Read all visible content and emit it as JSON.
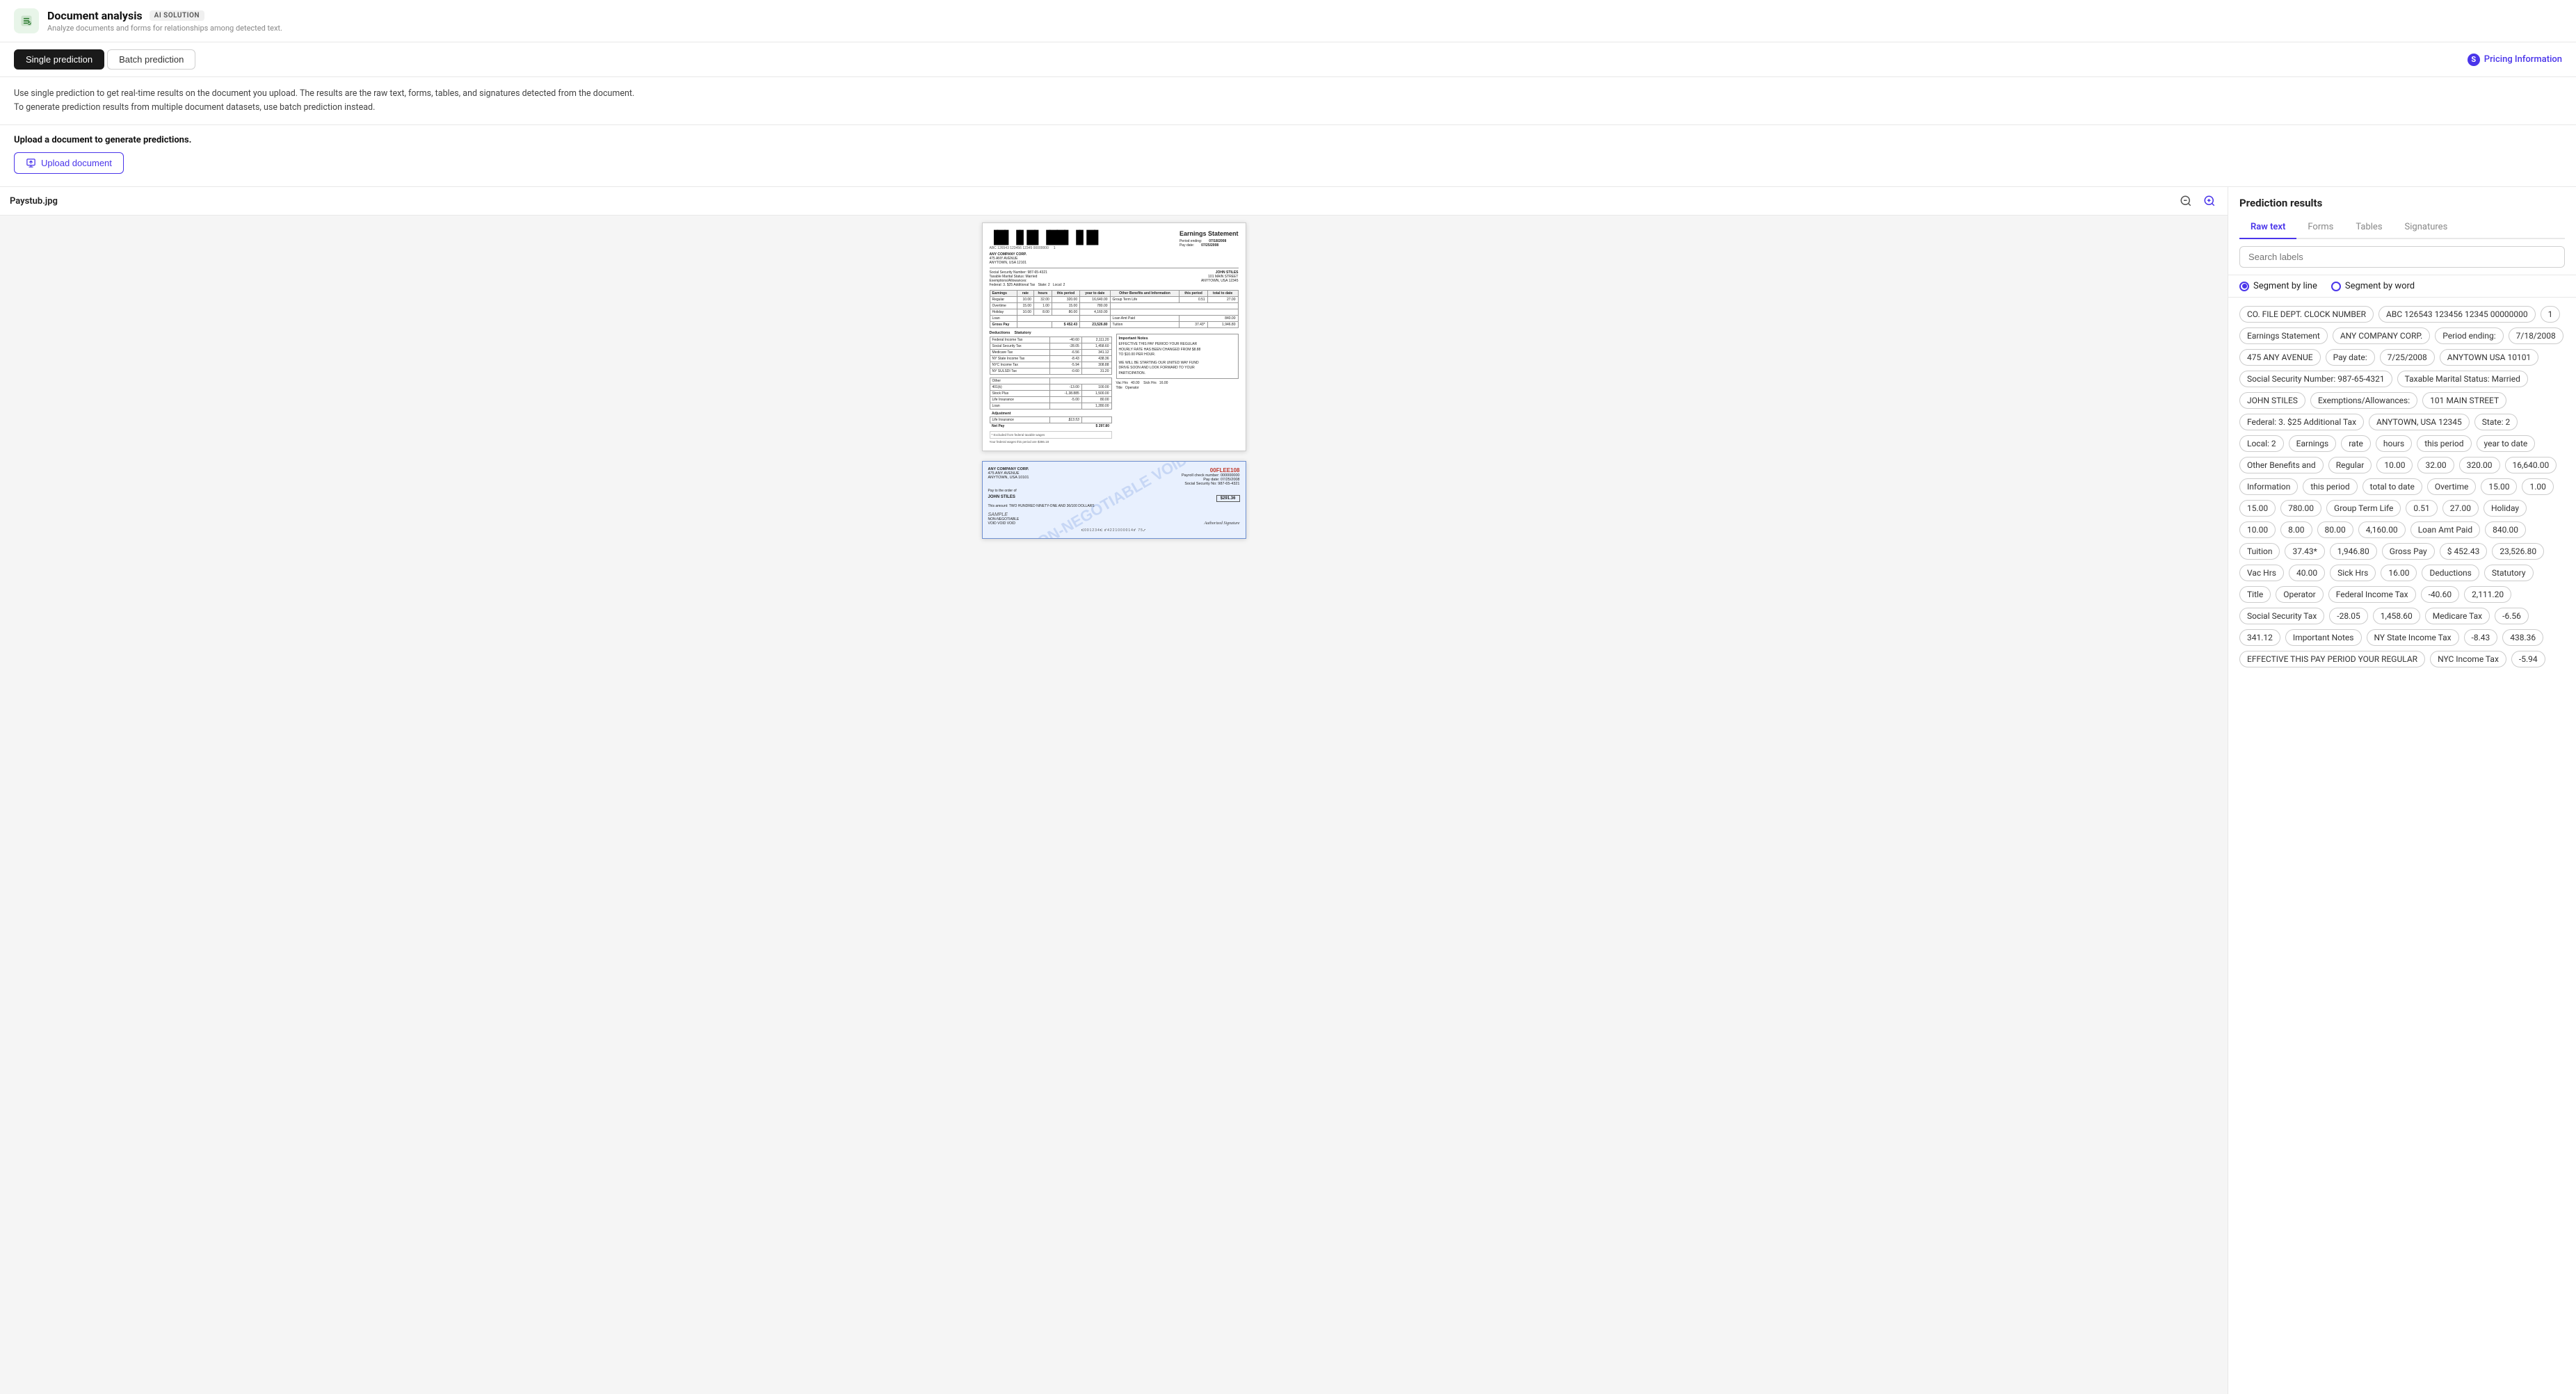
{
  "app": {
    "logo_color": "#e8f5e9",
    "title": "Document analysis",
    "badge": "AI SOLUTION",
    "subtitle": "Analyze documents and forms for relationships among detected text."
  },
  "tabs": {
    "items": [
      {
        "label": "Single prediction",
        "active": true
      },
      {
        "label": "Batch prediction",
        "active": false
      }
    ],
    "pricing_label": "Pricing Information"
  },
  "info": {
    "line1": "Use single prediction to get real-time results on the document you upload. The results are the raw text, forms, tables, and signatures detected from the document.",
    "line2": "To generate prediction results from multiple document datasets, use batch prediction instead."
  },
  "upload": {
    "label": "Upload a document to generate predictions.",
    "button_label": "Upload document"
  },
  "document": {
    "filename": "Paystub.jpg"
  },
  "prediction": {
    "title": "Prediction results",
    "tabs": [
      "Raw text",
      "Forms",
      "Tables",
      "Signatures"
    ],
    "active_tab": "Raw text",
    "search_placeholder": "Search labels",
    "segment_options": [
      "Segment by line",
      "Segment by word"
    ],
    "active_segment": "Segment by line",
    "tags": [
      "CO. FILE DEPT. CLOCK NUMBER",
      "ABC 126543 123456 12345 00000000",
      "1",
      "Earnings Statement",
      "ANY COMPANY CORP.",
      "Period ending:",
      "7/18/2008",
      "475 ANY AVENUE",
      "Pay date:",
      "7/25/2008",
      "ANYTOWN USA 10101",
      "Social Security Number: 987-65-4321",
      "Taxable Marital Status: Married",
      "JOHN STILES",
      "Exemptions/Allowances:",
      "101 MAIN STREET",
      "Federal: 3. $25 Additional Tax",
      "ANYTOWN, USA 12345",
      "State: 2",
      "Local: 2",
      "Earnings",
      "rate",
      "hours",
      "this period",
      "year to date",
      "Other Benefits and",
      "Regular",
      "10.00",
      "32.00",
      "320.00",
      "16,640.00",
      "Information",
      "this period",
      "total to date",
      "Overtime",
      "15.00",
      "1.00",
      "15.00",
      "780.00",
      "Group Term Life",
      "0.51",
      "27.00",
      "Holiday",
      "10.00",
      "8.00",
      "80.00",
      "4,160.00",
      "Loan Amt Paid",
      "840.00",
      "Tuition",
      "37.43*",
      "1,946.80",
      "Gross Pay",
      "$ 452.43",
      "23,526.80",
      "Vac Hrs",
      "40.00",
      "Sick Hrs",
      "16.00",
      "Deductions",
      "Statutory",
      "Title",
      "Operator",
      "Federal Income Tax",
      "-40.60",
      "2,111.20",
      "Social Security Tax",
      "-28.05",
      "1,458.60",
      "Medicare Tax",
      "-6.56",
      "341.12",
      "Important Notes",
      "NY State Income Tax",
      "-8.43",
      "438.36",
      "EFFECTIVE THIS PAY PERIOD YOUR REGULAR",
      "NYC Income Tax",
      "-5.94"
    ]
  }
}
